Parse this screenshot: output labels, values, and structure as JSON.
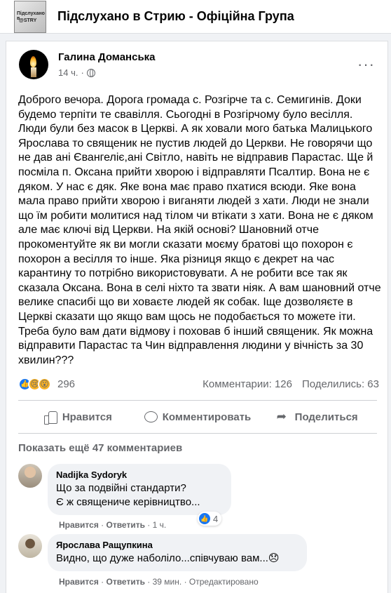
{
  "group": {
    "title": "Підслухано в Стрию - Офіційна Група",
    "thumb_line1": "Підслухано в",
    "thumb_line2": "@STRY"
  },
  "post": {
    "author": "Галина Доманська",
    "time": "14 ч.",
    "more": "···",
    "text": "Доброго вечора. Дорога громада с. Розгірче та с. Семигинів. Доки будемо терпіти те свавілля. Сьогодні в Розгірчому було весілля. Люди були без масок в Церкві. А як ховали мого батька Малицького Ярослава то священик не пустив людей до Церкви. Не говорячи що не дав ані Євангеліє,ані Світло, навіть не відправив Парастас. Ще й посміла п. Оксана прийти хворою і відправляти Псалтир. Вона не є дяком. У нас є дяк. Яке вона має право пхатися всюди. Яке вона мала право прийти хворою і виганяти людей з хати. Люди не знали що їм робити молитися над тілом чи втікати з хати. Вона не є дяком але має ключі від Церкви. На якій основі? Шановний отче прокоментуйте як ви могли сказати моєму братові що похорон є похорон а весілля то інше. Яка різниця якщо є декрет на час карантину то потрібно використовувати. А не робити все так як сказала Оксана. Вона в селі ніхто та звати ніяк. А вам шановний отче велике спасибі що ви ховаєте людей як собак. Іще дозволяєте в Церкві сказати що якщо вам щось не подобається то можете іти. Треба було вам дати відмову і поховав б інший священик. Як можна відправити Парастас та Чин відправлення людини у вічність за 30 хвилин???",
    "reaction_count": "296",
    "comments_count": "Комментарии: 126",
    "shares_count": "Поделились: 63"
  },
  "actions": {
    "like": "Нравится",
    "comment": "Комментировать",
    "share": "Поделиться"
  },
  "more_comments": "Показать ещё 47 комментариев",
  "comments": [
    {
      "name": "Nadijka Sydoryk",
      "text": "Що за подвійні стандарти?\nЄ ж священиче керівництво...",
      "like": "Нравится",
      "reply": "Ответить",
      "time": "1 ч.",
      "reactions": "4"
    },
    {
      "name": "Ярослава Ращупкина",
      "text": "Видно, що дуже наболіло...співчуваю вам...😞",
      "like": "Нравится",
      "reply": "Ответить",
      "time": "39 мин.",
      "edited": "Отредактировано"
    }
  ]
}
